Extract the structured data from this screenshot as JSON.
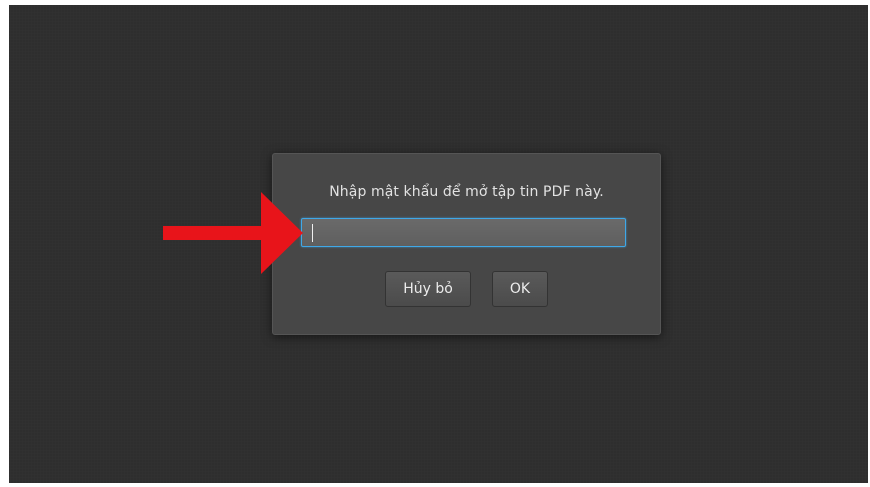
{
  "dialog": {
    "prompt": "Nhập mật khẩu để mở tập tin PDF này.",
    "password_value": "",
    "cancel_label": "Hủy bỏ",
    "ok_label": "OK"
  },
  "colors": {
    "viewer_background": "#2e2e2e",
    "dialog_background": "#474747",
    "input_focus_border": "#3fa8e8",
    "annotation_arrow": "#e8141a"
  },
  "annotation": {
    "icon": "red-arrow-icon"
  }
}
